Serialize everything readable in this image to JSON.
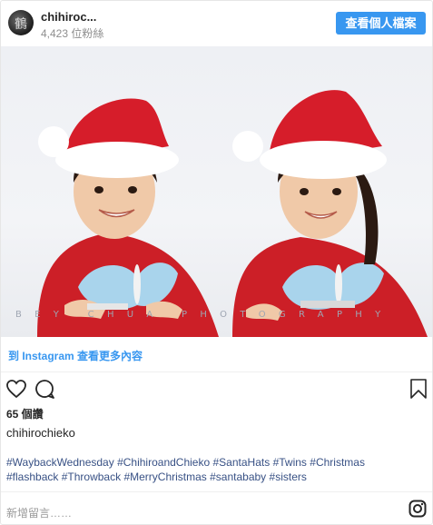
{
  "header": {
    "username": "chihiroc...",
    "followers": "4,423 位粉絲",
    "view_profile_label": "查看個人檔案"
  },
  "photo": {
    "watermark": "BEY CHUA PHOTOGRAPHY"
  },
  "view_more_label": "到 Instagram 查看更多內容",
  "actions": {
    "icons": [
      "heart-icon",
      "comment-icon",
      "bookmark-icon"
    ]
  },
  "likes": "65 個讚",
  "author": "chihirochieko",
  "hashtags": [
    "#WaybackWednesday",
    "#ChihiroandChieko",
    "#SantaHats",
    "#Twins",
    "#Christmas",
    "#flashback",
    "#Throwback",
    "#MerryChristmas",
    "#santababy",
    "#sisters"
  ],
  "add_comment_placeholder": "新增留言……",
  "colors": {
    "accent": "#3897f0",
    "hashtag": "#385185",
    "santa_hat": "#d61d2a"
  }
}
